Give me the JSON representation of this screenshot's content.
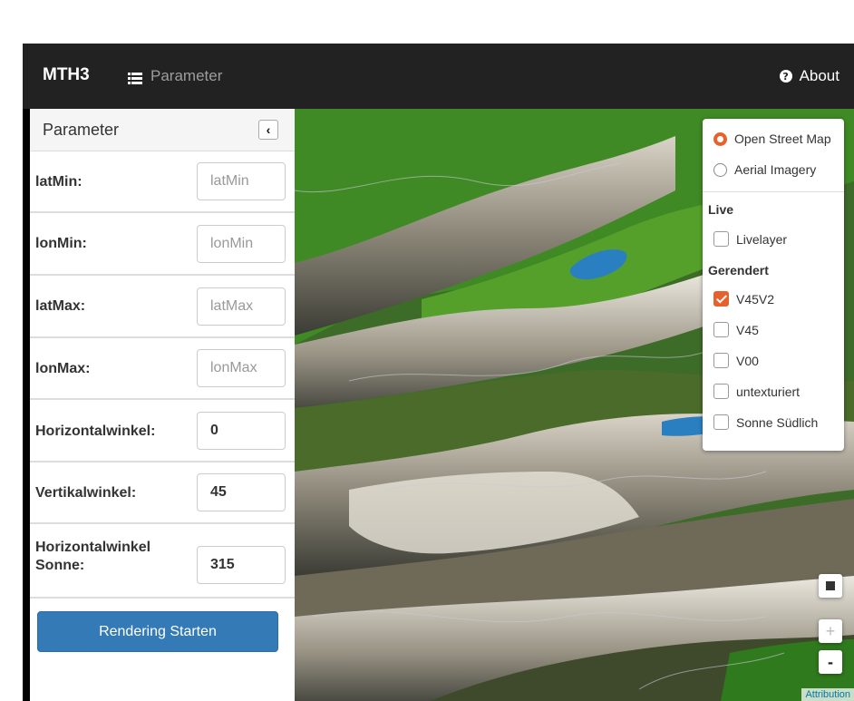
{
  "navbar": {
    "brand": "MTH3",
    "param_link": "Parameter",
    "about_link": "About",
    "about_icon": "?",
    "icons": {
      "list": "list-icon",
      "about": "question-circle-icon"
    }
  },
  "sidebar": {
    "title": "Parameter",
    "collapse_icon": "‹",
    "fields": [
      {
        "label": "latMin",
        "value": "",
        "placeholder": "latMin"
      },
      {
        "label": "lonMin",
        "value": "",
        "placeholder": "lonMin"
      },
      {
        "label": "latMax",
        "value": "",
        "placeholder": "latMax"
      },
      {
        "label": "lonMax",
        "value": "",
        "placeholder": "lonMax"
      },
      {
        "label": "Horizontalwinkel:",
        "value": "0",
        "placeholder": ""
      },
      {
        "label": "Vertikalwinkel:",
        "value": "45",
        "placeholder": ""
      },
      {
        "label": "Horizontalwinkel Sonne:",
        "value": "315",
        "placeholder": ""
      }
    ],
    "field_labels_display": [
      "latMin:",
      "lonMin:",
      "latMax:",
      "lonMax:",
      "Horizontalwinkel:",
      "Vertikalwinkel:",
      "Horizontalwinkel Sonne:"
    ],
    "render_button": "Rendering Starten"
  },
  "layers": {
    "base": [
      {
        "label": "Open Street Map",
        "selected": true
      },
      {
        "label": "Aerial Imagery",
        "selected": false
      }
    ],
    "live_heading": "Live",
    "live": [
      {
        "label": "Livelayer",
        "checked": false
      }
    ],
    "rendered_heading": "Gerendert",
    "rendered": [
      {
        "label": "V45V2",
        "checked": true
      },
      {
        "label": "V45",
        "checked": false
      },
      {
        "label": "V00",
        "checked": false
      },
      {
        "label": "untexturiert",
        "checked": false
      },
      {
        "label": "Sonne Südlich",
        "checked": false
      }
    ]
  },
  "map_controls": {
    "zoom_in": "+",
    "zoom_out": "-",
    "attribution": "Attribution"
  },
  "colors": {
    "accent": "#e8612c",
    "primary_button": "#337ab7",
    "navbar": "#222222"
  }
}
